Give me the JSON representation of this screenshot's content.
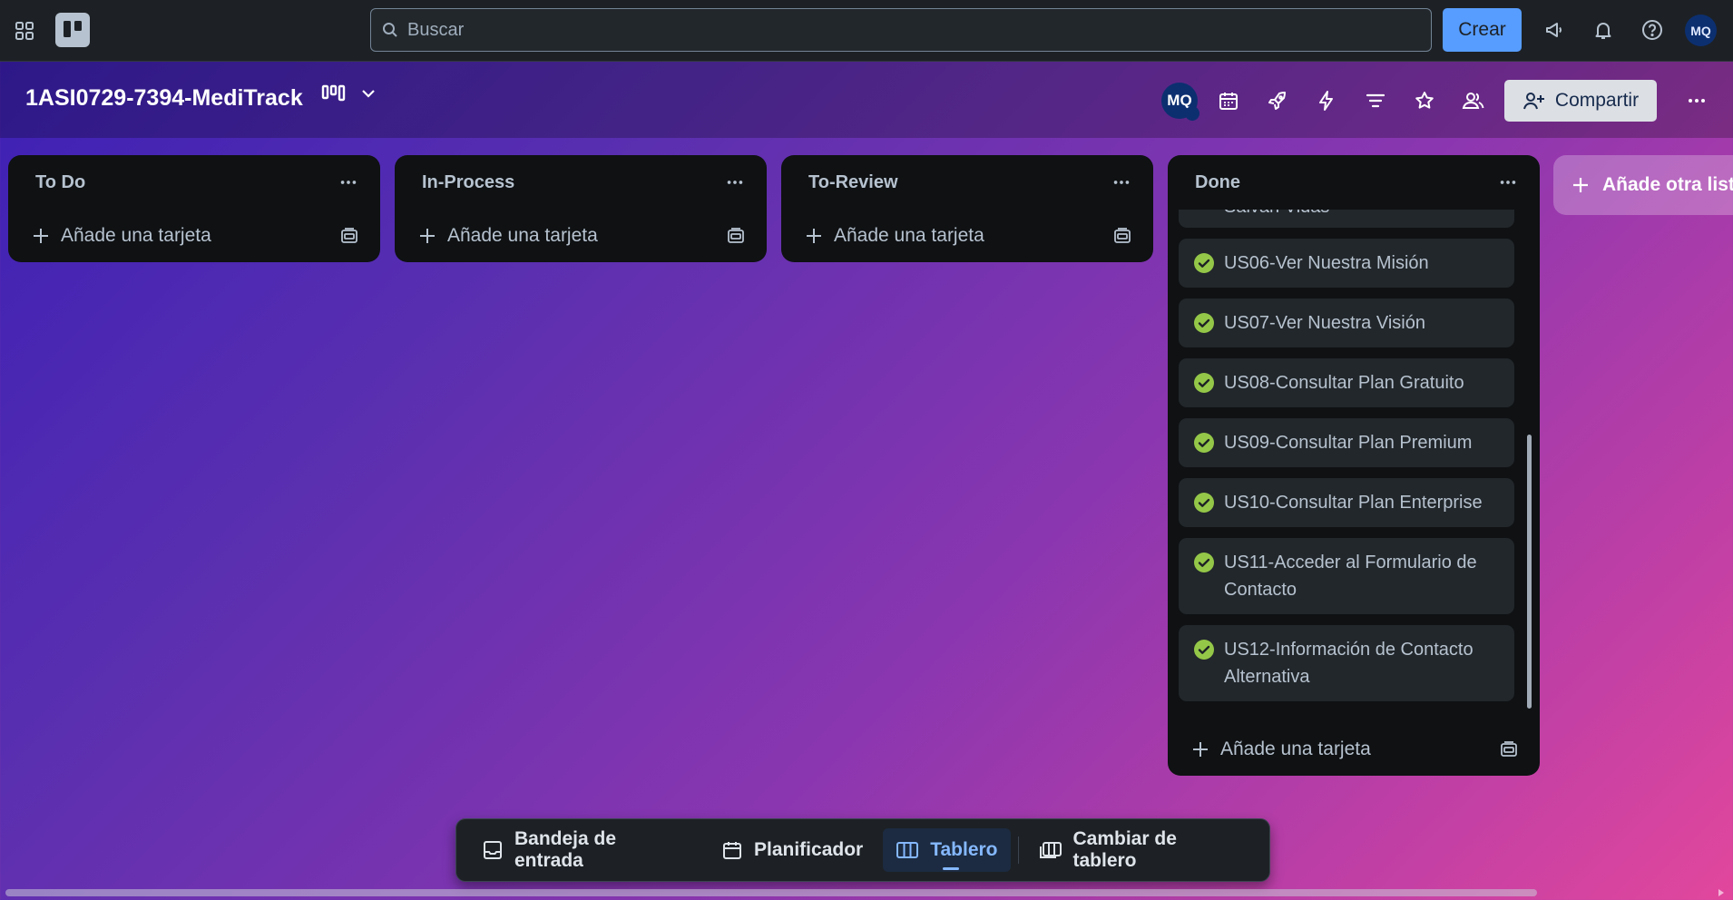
{
  "topbar": {
    "search_placeholder": "Buscar",
    "create_label": "Crear",
    "avatar_initials": "MQ"
  },
  "board": {
    "title": "1ASI0729-7394-MediTrack",
    "member_initials": "MQ",
    "share_label": "Compartir"
  },
  "lists": [
    {
      "title": "To Do",
      "add_card_label": "Añade una tarjeta",
      "cards": []
    },
    {
      "title": "In-Process",
      "add_card_label": "Añade una tarjeta",
      "cards": []
    },
    {
      "title": "To-Review",
      "add_card_label": "Añade una tarjeta",
      "cards": []
    },
    {
      "title": "Done",
      "add_card_label": "Añade una tarjeta",
      "partial_card": "Salvan Vidas",
      "cards": [
        "US06-Ver Nuestra Misión",
        "US07-Ver Nuestra Visión",
        "US08-Consultar Plan Gratuito",
        "US09-Consultar Plan Premium",
        "US10-Consultar Plan Enterprise",
        "US11-Acceder al Formulario de Contacto",
        "US12-Información de Contacto Alternativa"
      ]
    }
  ],
  "add_list_label": "Añade otra lista",
  "bottom_nav": {
    "inbox": "Bandeja de entrada",
    "planner": "Planificador",
    "board": "Tablero",
    "switch_board": "Cambiar de tablero"
  },
  "colors": {
    "topbar_bg": "#1d2125",
    "create_button": "#579dff",
    "list_bg": "#0f1113",
    "card_bg": "#22272b",
    "done_check": "#94c748",
    "active_tab": "#85b8ff"
  },
  "icons": [
    "apps-icon",
    "trello-logo-icon",
    "search-icon",
    "megaphone-icon",
    "bell-icon",
    "help-icon",
    "board-view-icon",
    "chevron-down-icon",
    "calendar-icon",
    "rocket-icon",
    "bolt-icon",
    "filter-icon",
    "star-icon",
    "members-icon",
    "add-member-icon",
    "more-icon",
    "plus-icon",
    "template-icon",
    "check-circle-icon",
    "inbox-icon",
    "planner-icon",
    "board-icon",
    "switch-board-icon"
  ]
}
